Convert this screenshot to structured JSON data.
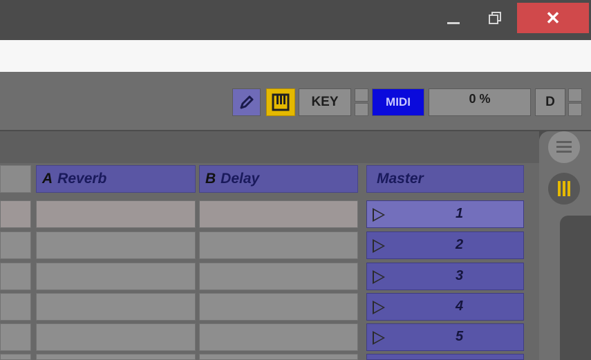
{
  "window": {
    "minimize_label": "minimize",
    "restore_label": "restore",
    "close_glyph": "✕"
  },
  "control_bar": {
    "key_label": "KEY",
    "midi_label": "MIDI",
    "cpu_load": "0 %",
    "d_label": "D",
    "icons": [
      "pencil-icon",
      "piano-keys-icon"
    ]
  },
  "tracks": {
    "headers": [
      {
        "prefix": "A",
        "name": "Reverb"
      },
      {
        "prefix": "B",
        "name": "Delay"
      }
    ],
    "master": "Master"
  },
  "scenes": [
    "1",
    "2",
    "3",
    "4",
    "5"
  ],
  "side_panel": {
    "icons": [
      "hamburger-list-icon",
      "mixer-bars-icon"
    ]
  },
  "colors": {
    "track_header": "#5a56a4",
    "midi_active": "#0a0adc",
    "keys_active": "#e5b900",
    "close": "#d0494b"
  }
}
